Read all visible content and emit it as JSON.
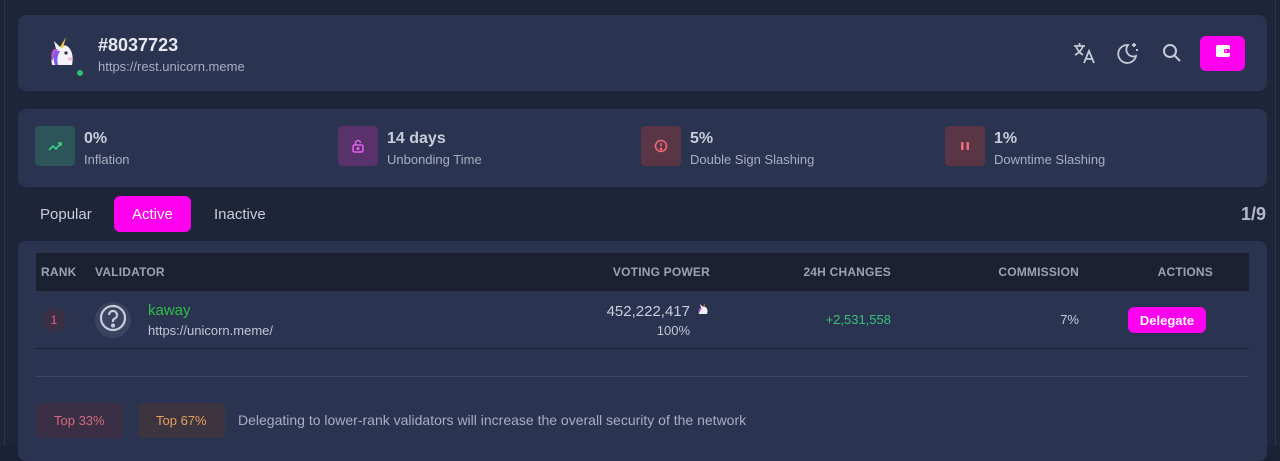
{
  "header": {
    "title": "#8037723",
    "endpoint": "https://rest.unicorn.meme",
    "icons": [
      "translate-icon",
      "theme-toggle-icon",
      "search-icon",
      "wallet-icon"
    ]
  },
  "stats": [
    {
      "value": "0%",
      "label": "Inflation",
      "icon": "trend-up-icon",
      "color": "#2fbf71"
    },
    {
      "value": "14 days",
      "label": "Unbonding Time",
      "icon": "lock-open-icon",
      "color": "#c44fd0"
    },
    {
      "value": "5%",
      "label": "Double Sign Slashing",
      "icon": "alert-circle-icon",
      "color": "#e05a6a"
    },
    {
      "value": "1%",
      "label": "Downtime Slashing",
      "icon": "pause-icon",
      "color": "#e05a6a"
    }
  ],
  "tabs": [
    {
      "label": "Popular",
      "active": false
    },
    {
      "label": "Active",
      "active": true
    },
    {
      "label": "Inactive",
      "active": false
    }
  ],
  "pager": "1/9",
  "table": {
    "headers": {
      "rank": "RANK",
      "validator": "VALIDATOR",
      "voting_power": "VOTING POWER",
      "changes": "24H CHANGES",
      "commission": "COMMISSION",
      "actions": "ACTIONS"
    },
    "rows": [
      {
        "rank": "1",
        "name": "kaway",
        "website": "https://unicorn.meme/",
        "voting_power": "452,222,417",
        "voting_share": "100%",
        "change": "+2,531,558",
        "commission": "7%",
        "action": "Delegate"
      }
    ]
  },
  "legend": {
    "top33": "Top 33%",
    "top67": "Top 67%",
    "note": "Delegating to lower-rank validators will increase the overall security of the network"
  },
  "colors": {
    "accent": "#ff00ee",
    "positive": "#39c07a",
    "validator_name": "#2fbf47"
  }
}
